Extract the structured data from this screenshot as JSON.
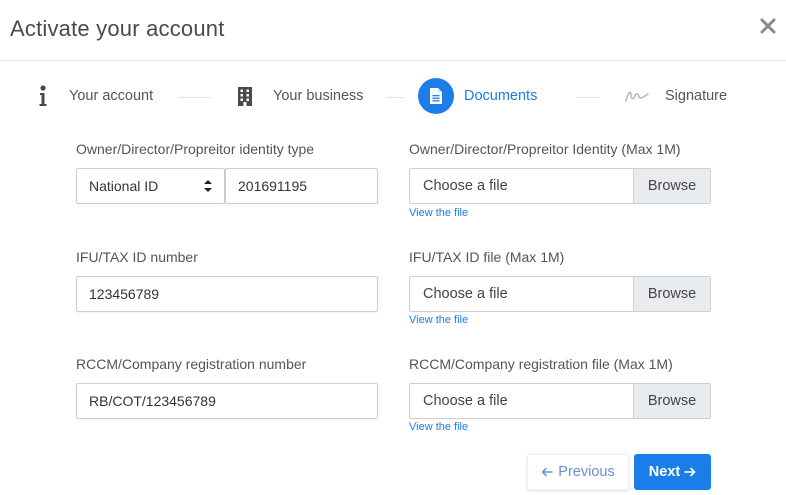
{
  "modal": {
    "title": "Activate your account"
  },
  "stepper": {
    "steps": [
      {
        "label": "Your account",
        "icon": "info-icon",
        "active": false
      },
      {
        "label": "Your business",
        "icon": "building-icon",
        "active": false
      },
      {
        "label": "Documents",
        "icon": "document-icon",
        "active": true
      },
      {
        "label": "Signature",
        "icon": "signature-icon",
        "active": false
      }
    ]
  },
  "form": {
    "identity_type": {
      "label": "Owner/Director/Propreitor identity type",
      "selected": "National ID",
      "number_value": "201691195"
    },
    "identity_file": {
      "label": "Owner/Director/Propreitor Identity (Max 1M)",
      "placeholder": "Choose a file",
      "browse": "Browse",
      "view_link": "View the file"
    },
    "tax_number": {
      "label": "IFU/TAX ID number",
      "value": "123456789"
    },
    "tax_file": {
      "label": "IFU/TAX ID file (Max 1M)",
      "placeholder": "Choose a file",
      "browse": "Browse",
      "view_link": "View the file"
    },
    "rccm_number": {
      "label": "RCCM/Company registration number",
      "value": "RB/COT/123456789"
    },
    "rccm_file": {
      "label": "RCCM/Company registration file (Max 1M)",
      "placeholder": "Choose a file",
      "browse": "Browse",
      "view_link": "View the file"
    }
  },
  "footer": {
    "previous_label": "Previous",
    "next_label": "Next"
  },
  "colors": {
    "accent": "#1a7de8",
    "previous_text": "#6b8fd6"
  }
}
